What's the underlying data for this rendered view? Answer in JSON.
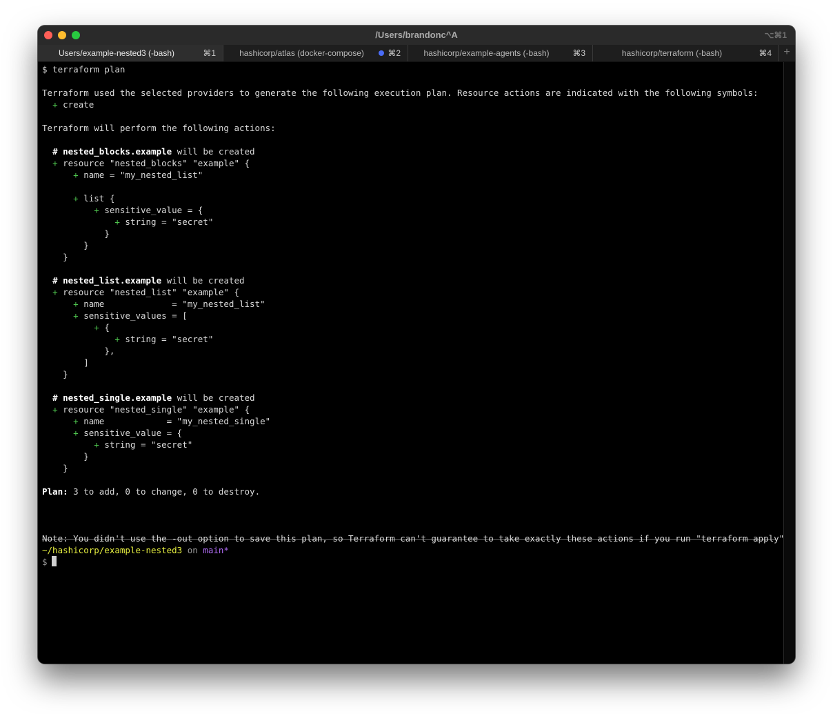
{
  "window": {
    "title": "/Users/brandonc^A",
    "title_shortcut": "⌥⌘1"
  },
  "tabs": [
    {
      "label": "Users/example-nested3 (-bash)",
      "shortcut": "⌘1",
      "active": true
    },
    {
      "label": "hashicorp/atlas (docker-compose)",
      "shortcut": "⌘2",
      "has_activity_dot": true
    },
    {
      "label": "hashicorp/example-agents (-bash)",
      "shortcut": "⌘3"
    },
    {
      "label": "hashicorp/terraform (-bash)",
      "shortcut": "⌘4"
    }
  ],
  "tab_add_label": "+",
  "colors": {
    "plus": "#4ec44e",
    "path": "#e7f040",
    "branch": "#b06cf5",
    "activity_dot": "#4a6cf7"
  },
  "terminal": {
    "command_prompt": "$",
    "command": "terraform plan",
    "intro": "Terraform used the selected providers to generate the following execution plan. Resource actions are indicated with the following symbols:",
    "symbol_create": "create",
    "perform": "Terraform will perform the following actions:",
    "r1": {
      "hash": "#",
      "address": "nested_blocks.example",
      "will": "will be created",
      "resource_line": "resource \"nested_blocks\" \"example\" {",
      "name_line": "name = \"my_nested_list\"",
      "list_line": "list {",
      "sv_line": "sensitive_value = {",
      "string_line": "string = \"secret\"",
      "close1": "}",
      "close2": "}",
      "close3": "}"
    },
    "r2": {
      "hash": "#",
      "address": "nested_list.example",
      "will": "will be created",
      "resource_line": "resource \"nested_list\" \"example\" {",
      "name_line": "name             = \"my_nested_list\"",
      "svs_line": "sensitive_values = [",
      "open_brace": "{",
      "string_line": "string = \"secret\"",
      "close_obj": "},",
      "close_list": "]",
      "close_res": "}"
    },
    "r3": {
      "hash": "#",
      "address": "nested_single.example",
      "will": "will be created",
      "resource_line": "resource \"nested_single\" \"example\" {",
      "name_line": "name            = \"my_nested_single\"",
      "sv_line": "sensitive_value = {",
      "string_line": "string = \"secret\"",
      "close1": "}",
      "close2": "}"
    },
    "plan_label": "Plan:",
    "plan_text": "3 to add, 0 to change, 0 to destroy.",
    "note": "Note: You didn't use the -out option to save this plan, so Terraform can't guarantee to take exactly these actions if you run \"terraform apply\" now.",
    "prompt_path": "~/hashicorp/example-nested3",
    "prompt_on": "on",
    "prompt_branch": "main*",
    "prompt_symbol": "$"
  }
}
